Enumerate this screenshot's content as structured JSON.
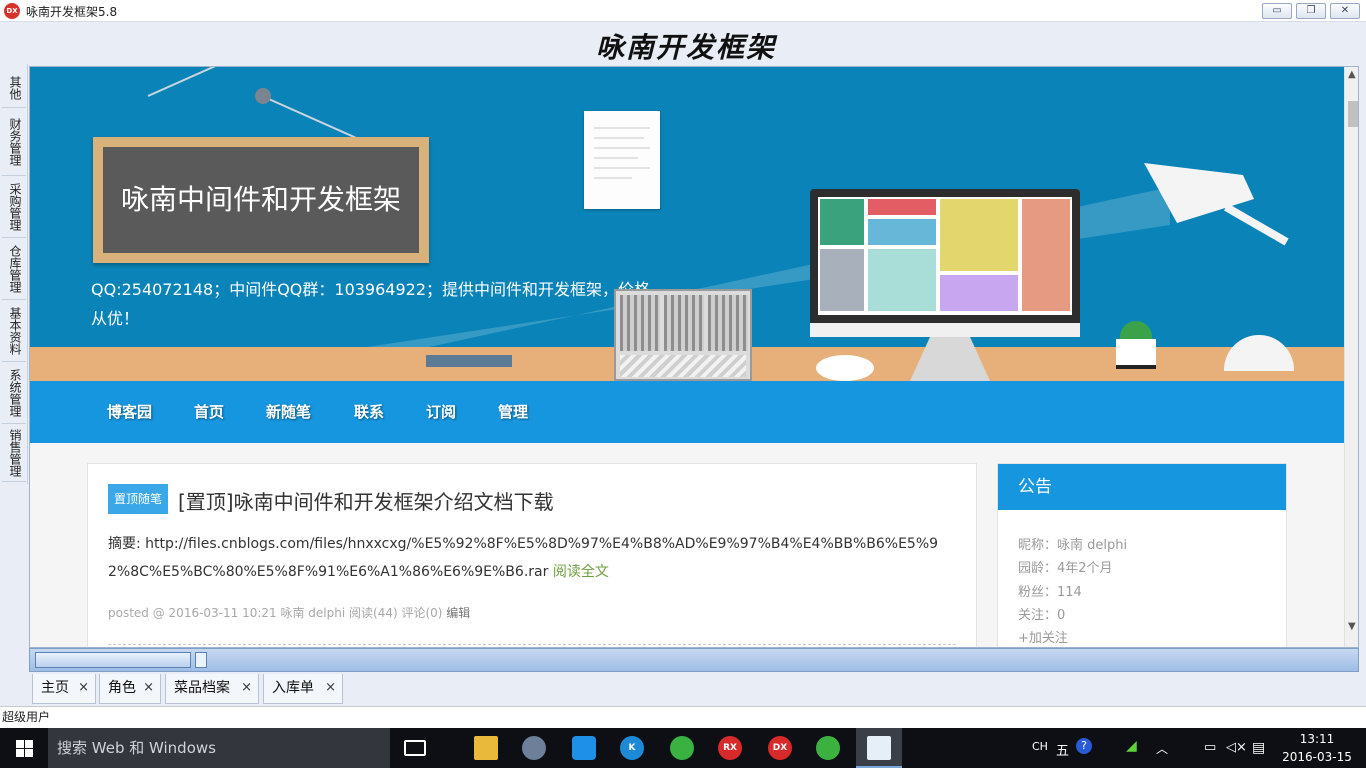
{
  "window": {
    "app_icon": "DX",
    "title": "咏南开发框架5.8",
    "minimize": "▭",
    "maximize": "❐",
    "close": "✕"
  },
  "brand": {
    "title": "咏南开发框架"
  },
  "left_tabs": [
    "其他",
    "财务管理",
    "采购管理",
    "仓库管理",
    "基本资料",
    "系统管理",
    "销售管理"
  ],
  "blog": {
    "board_title": "咏南中间件和开发框架",
    "description": "QQ:254072148；中间件QQ群：103964922；提供中间件和开发框架，价格从优！",
    "nav": [
      "博客园",
      "首页",
      "新随笔",
      "联系",
      "订阅",
      "管理"
    ],
    "post": {
      "badge": "置顶随笔",
      "title": "[置顶]咏南中间件和开发框架介绍文档下载",
      "summary": "摘要: http://files.cnblogs.com/files/hnxxcxg/%E5%92%8F%E5%8D%97%E4%B8%AD%E9%97%B4%E4%BB%B6%E5%92%8C%E5%BC%80%E5%8F%91%E6%A1%86%E6%9E%B6.rar",
      "read_more": "阅读全文",
      "meta": "posted @ 2016-03-11 10:21 咏南 delphi 阅读(44) 评论(0)",
      "edit": "编辑"
    },
    "notice": {
      "title": "公告",
      "nickname": "昵称：咏南 delphi",
      "age": "园龄：4年2个月",
      "fans": "粉丝：114",
      "follow": "关注：0",
      "add_follow": "+加关注"
    }
  },
  "doc_tabs": [
    {
      "label": "主页",
      "close": "×"
    },
    {
      "label": "角色",
      "close": "×"
    },
    {
      "label": "菜品档案",
      "close": "×"
    },
    {
      "label": "入库单",
      "close": "×"
    }
  ],
  "status": {
    "user": "超级用户"
  },
  "taskbar": {
    "search_placeholder": "搜索 Web 和 Windows",
    "tray_lang": "CH",
    "tray_ime": "五",
    "tray_help": "?",
    "time": "13:11",
    "date": "2016-03-15",
    "app_rx": "RX",
    "app_dx": "DX",
    "app_k": "K"
  },
  "colors": {
    "hero_bg": "#0a84b8",
    "nav_bg": "#1796e0",
    "read_more": "#6f9e3c",
    "taskbar_bg": "#0d0f14"
  }
}
